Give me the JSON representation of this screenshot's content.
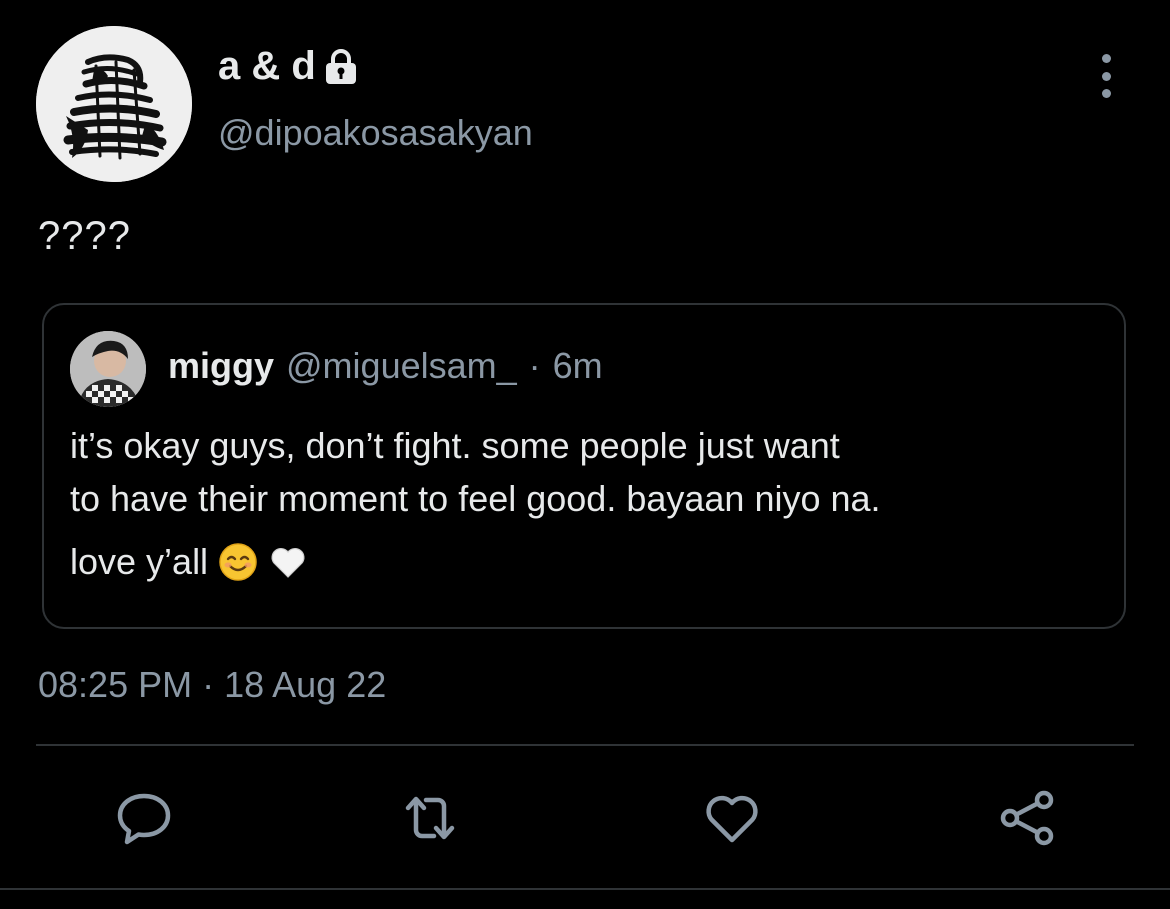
{
  "author": {
    "display_name": "a & d",
    "handle": "@dipoakosasakyan",
    "protected_icon": "lock-icon",
    "avatar_icon": "avatar-art"
  },
  "tweet": {
    "text": "????",
    "timestamp": "08:25 PM · 18 Aug 22"
  },
  "quoted_tweet": {
    "name": "miggy",
    "handle": "@miguelsam_",
    "separator": "·",
    "time": "6m",
    "line1": "it’s okay guys, don’t fight. some people just want",
    "line2": "to have their moment to feel good. bayaan niyo na.",
    "line3": "love y’all",
    "emojis": [
      "smiling-face-emoji",
      "white-heart-emoji"
    ]
  },
  "actions": {
    "reply_icon": "reply-icon",
    "retweet_icon": "retweet-icon",
    "like_icon": "heart-icon",
    "share_icon": "share-icon",
    "more_icon": "more-vertical-icon"
  },
  "colors": {
    "background": "#000000",
    "primary_text": "#e7e9ea",
    "secondary_text": "#8b98a5",
    "border": "#2f3336"
  }
}
